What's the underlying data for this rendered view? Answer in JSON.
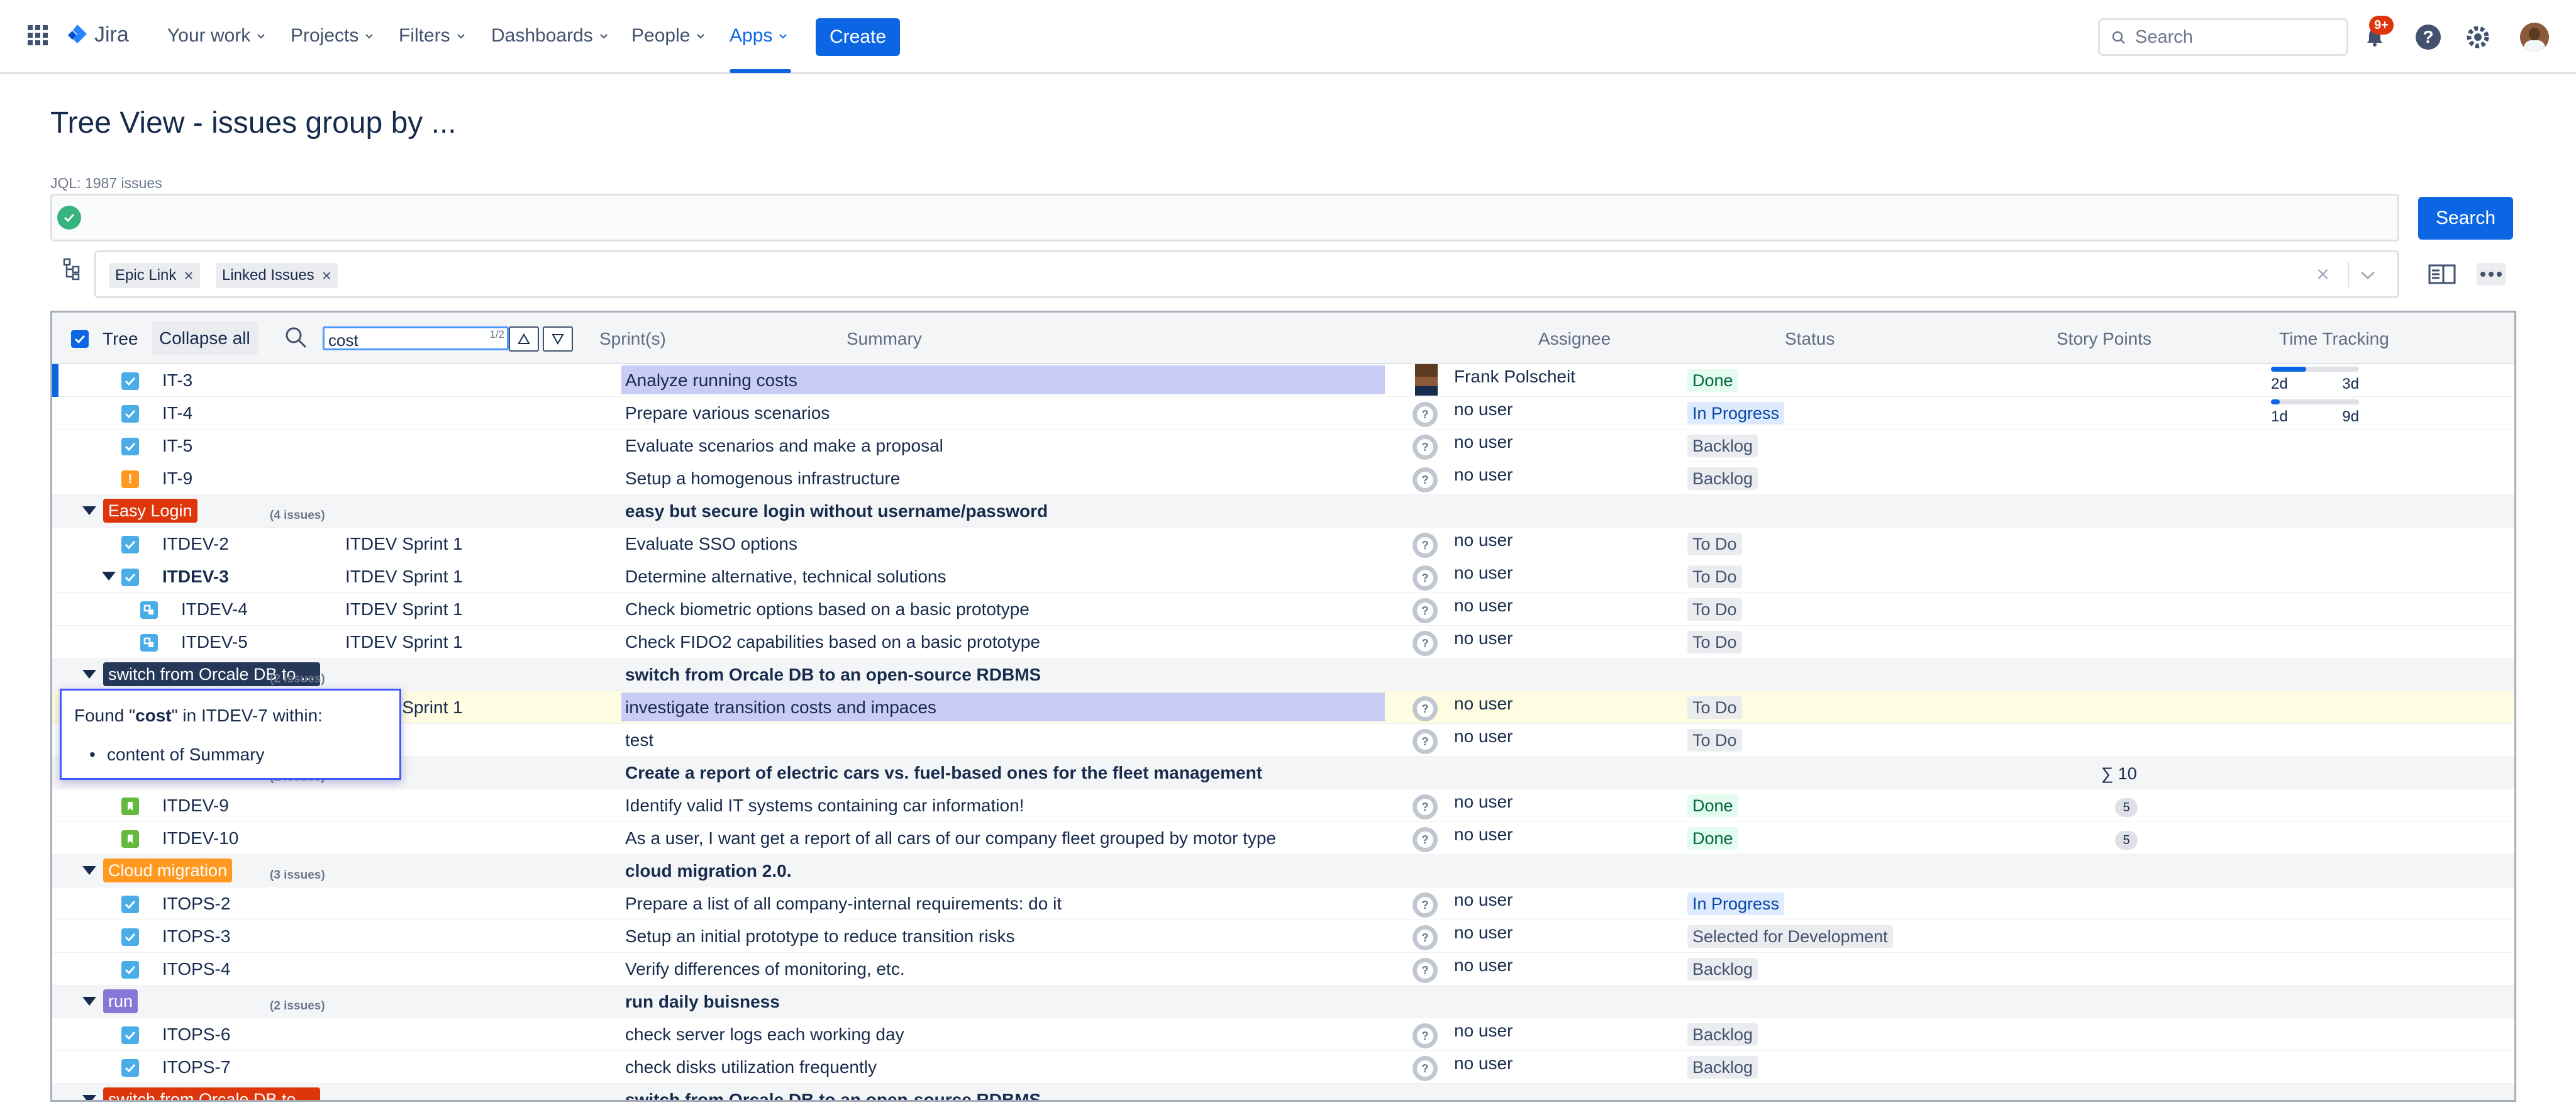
{
  "topbar": {
    "logo": "Jira",
    "nav": [
      "Your work",
      "Projects",
      "Filters",
      "Dashboards",
      "People",
      "Apps"
    ],
    "create": "Create",
    "search_placeholder": "Search",
    "notif_count": "9+",
    "accent": "#0c66e4"
  },
  "page": {
    "title": "Tree View - issues group by ...",
    "jql_count": "JQL: 1987 issues",
    "search_button": "Search",
    "chips": [
      "Epic Link",
      "Linked Issues"
    ]
  },
  "table": {
    "tree_label": "Tree",
    "collapse_all": "Collapse all",
    "find_value": "cost",
    "find_counter": "1/2",
    "headers": {
      "sprints": "Sprint(s)",
      "summary": "Summary",
      "assignee": "Assignee",
      "status": "Status",
      "story_points": "Story Points",
      "time_tracking": "Time Tracking"
    },
    "time_tracking": [
      {
        "logged": "2d",
        "remaining": "3d",
        "progress": 0.4
      },
      {
        "logged": "1d",
        "remaining": "9d",
        "progress": 0.1
      }
    ],
    "rows": [
      {
        "kind": "issue",
        "key": "IT-3",
        "summary": "Analyze running costs",
        "assignee": "Frank Polscheit",
        "status": "Done",
        "icon": "task",
        "highlight": "summary"
      },
      {
        "kind": "issue",
        "key": "IT-4",
        "summary": "Prepare various scenarios",
        "assignee": "no user",
        "status": "In Progress",
        "icon": "task"
      },
      {
        "kind": "issue",
        "key": "IT-5",
        "summary": "Evaluate scenarios and make a proposal",
        "assignee": "no user",
        "status": "Backlog",
        "icon": "task"
      },
      {
        "kind": "issue",
        "key": "IT-9",
        "summary": "Setup a homogenous infrastructure",
        "assignee": "no user",
        "status": "Backlog",
        "icon": "bug"
      },
      {
        "kind": "group",
        "label": "Easy Login",
        "color": "#de350b",
        "count": "(4 issues)",
        "summary": "easy but secure login without username/password"
      },
      {
        "kind": "issue",
        "key": "ITDEV-2",
        "sprint": "ITDEV Sprint 1",
        "summary": "Evaluate SSO options",
        "assignee": "no user",
        "status": "To Do",
        "icon": "task"
      },
      {
        "kind": "issue",
        "key": "ITDEV-3",
        "sprint": "ITDEV Sprint 1",
        "summary": "Determine alternative, technical solutions",
        "assignee": "no user",
        "status": "To Do",
        "icon": "task",
        "bold": true,
        "expand": true
      },
      {
        "kind": "issue",
        "key": "ITDEV-4",
        "sprint": "ITDEV Sprint 1",
        "summary": "Check biometric options based on a basic prototype",
        "assignee": "no user",
        "status": "To Do",
        "icon": "subtask",
        "indent": true
      },
      {
        "kind": "issue",
        "key": "ITDEV-5",
        "sprint": "ITDEV Sprint 1",
        "summary": "Check FIDO2 capabilities based on a basic prototype",
        "assignee": "no user",
        "status": "To Do",
        "icon": "subtask",
        "indent": true
      },
      {
        "kind": "group",
        "label": "switch from Orcale DB to ...",
        "color": "#253858",
        "count": "(2 issues)",
        "summary": "switch from Orcale DB to an open-source RDBMS"
      },
      {
        "kind": "issue",
        "key": "",
        "sprint": "ITDEV Sprint 1",
        "summary": "investigate transition costs and impaces",
        "assignee": "no user",
        "status": "To Do",
        "icon": "none",
        "highlight": "row"
      },
      {
        "kind": "issue",
        "key": "",
        "sprint": "",
        "summary": "test",
        "assignee": "no user",
        "status": "To Do",
        "icon": "none"
      },
      {
        "kind": "group",
        "label": "",
        "color": "#f4f5f7",
        "count": "(2 issues)",
        "summary": "Create a report of electric cars vs. fuel-based ones for the fleet management",
        "sum": "∑ 10"
      },
      {
        "kind": "issue",
        "key": "ITDEV-9",
        "summary": "Identify valid IT systems containing car information!",
        "assignee": "no user",
        "status": "Done",
        "icon": "story",
        "points": "5"
      },
      {
        "kind": "issue",
        "key": "ITDEV-10",
        "summary": "As a user, I want get a report of all cars of our company fleet grouped by motor type",
        "assignee": "no user",
        "status": "Done",
        "icon": "story",
        "points": "5"
      },
      {
        "kind": "group",
        "label": "Cloud migration",
        "color": "#ff991f",
        "count": "(3 issues)",
        "summary": "cloud migration 2.0."
      },
      {
        "kind": "issue",
        "key": "ITOPS-2",
        "summary": "Prepare a list of all company-internal requirements: do it",
        "assignee": "no user",
        "status": "In Progress",
        "icon": "task"
      },
      {
        "kind": "issue",
        "key": "ITOPS-3",
        "summary": "Setup an initial prototype to reduce transition risks",
        "assignee": "no user",
        "status": "Selected for Development",
        "icon": "task"
      },
      {
        "kind": "issue",
        "key": "ITOPS-4",
        "summary": "Verify differences of monitoring, etc.",
        "assignee": "no user",
        "status": "Backlog",
        "icon": "task"
      },
      {
        "kind": "group",
        "label": "run",
        "color": "#8777d9",
        "count": "(2 issues)",
        "summary": "run daily buisness"
      },
      {
        "kind": "issue",
        "key": "ITOPS-6",
        "summary": "check server logs each working day",
        "assignee": "no user",
        "status": "Backlog",
        "icon": "task"
      },
      {
        "kind": "issue",
        "key": "ITOPS-7",
        "summary": "check disks utilization frequently",
        "assignee": "no user",
        "status": "Backlog",
        "icon": "task"
      },
      {
        "kind": "group",
        "label": "switch from Orcale DB to ...",
        "color": "#de350b",
        "count": "",
        "summary": "switch from Orcale DB to an open-source RDBMS"
      }
    ]
  },
  "tooltip": {
    "prefix": "Found \"",
    "term": "cost",
    "suffix": "\" in ITDEV-7 within:",
    "item": "content of Summary"
  }
}
